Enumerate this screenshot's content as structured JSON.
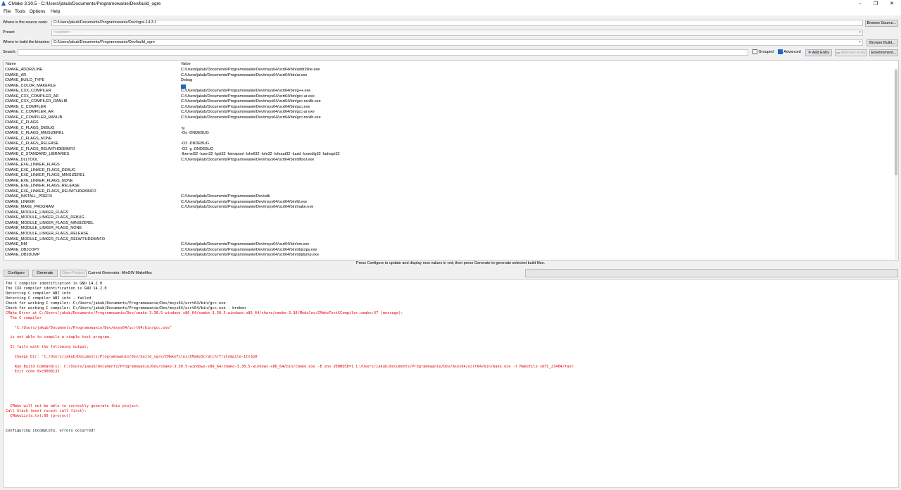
{
  "window": {
    "title": "CMake 3.30.5 - C:/Users/jakub/Documents/Programowanie/Dev/build_ogre",
    "minimize": "–",
    "maximize": "❐",
    "close": "✕"
  },
  "menu": [
    "File",
    "Tools",
    "Options",
    "Help"
  ],
  "source": {
    "label": "Where is the source code:",
    "value": "C:/Users/jakub/Documents/Programowanie/Dev/ogre-14.3.1",
    "browse": "Browse Source..."
  },
  "preset": {
    "label": "Preset:",
    "value": "<custom>"
  },
  "build": {
    "label": "Where to build the binaries:",
    "value": "C:/Users/jakub/Documents/Programowanie/Dev/build_ogre",
    "browse": "Browse Build..."
  },
  "search": {
    "label": "Search:",
    "value": "",
    "grouped": "Grouped",
    "advanced": "Advanced",
    "add_entry": "Add Entry",
    "remove_entry": "Remove Entry",
    "environment": "Environment..."
  },
  "table": {
    "col_name": "Name",
    "col_value": "Value",
    "rows": [
      {
        "name": "CMAKE_ADDR2LINE",
        "value": "C:/Users/jakub/Documents/Programowanie/Dev/msys64/ucrt64/bin/addr2line.exe"
      },
      {
        "name": "CMAKE_AR",
        "value": "C:/Users/jakub/Documents/Programowanie/Dev/msys64/ucrt64/bin/ar.exe"
      },
      {
        "name": "CMAKE_BUILD_TYPE",
        "value": "Debug"
      },
      {
        "name": "CMAKE_COLOR_MAKEFILE",
        "value": "",
        "checkbox": true
      },
      {
        "name": "CMAKE_CXX_COMPILER",
        "value": "C:/Users/jakub/Documents/Programowanie/Dev/msys64/ucrt64/bin/g++.exe"
      },
      {
        "name": "CMAKE_CXX_COMPILER_AR",
        "value": "C:/Users/jakub/Documents/Programowanie/Dev/msys64/ucrt64/bin/gcc-ar.exe"
      },
      {
        "name": "CMAKE_CXX_COMPILER_RANLIB",
        "value": "C:/Users/jakub/Documents/Programowanie/Dev/msys64/ucrt64/bin/gcc-ranlib.exe"
      },
      {
        "name": "CMAKE_C_COMPILER",
        "value": "C:/Users/jakub/Documents/Programowanie/Dev/msys64/ucrt64/bin/gcc.exe"
      },
      {
        "name": "CMAKE_C_COMPILER_AR",
        "value": "C:/Users/jakub/Documents/Programowanie/Dev/msys64/ucrt64/bin/gcc-ar.exe"
      },
      {
        "name": "CMAKE_C_COMPILER_RANLIB",
        "value": "C:/Users/jakub/Documents/Programowanie/Dev/msys64/ucrt64/bin/gcc-ranlib.exe"
      },
      {
        "name": "CMAKE_C_FLAGS",
        "value": ""
      },
      {
        "name": "CMAKE_C_FLAGS_DEBUG",
        "value": "-g"
      },
      {
        "name": "CMAKE_C_FLAGS_MINSIZEREL",
        "value": "-Os -DNDEBUG"
      },
      {
        "name": "CMAKE_C_FLAGS_NONE",
        "value": ""
      },
      {
        "name": "CMAKE_C_FLAGS_RELEASE",
        "value": "-O3 -DNDEBUG"
      },
      {
        "name": "CMAKE_C_FLAGS_RELWITHDEBINFO",
        "value": "-O2 -g -DNDEBUG"
      },
      {
        "name": "CMAKE_C_STANDARD_LIBRARIES",
        "value": "-lkernel32 -luser32 -lgdi32 -lwinspool -lshell32 -lole32 -loleaut32 -luuid -lcomdlg32 -ladvapi32"
      },
      {
        "name": "CMAKE_DLLTOOL",
        "value": "C:/Users/jakub/Documents/Programowanie/Dev/msys64/ucrt64/bin/dlltool.exe"
      },
      {
        "name": "CMAKE_EXE_LINKER_FLAGS",
        "value": ""
      },
      {
        "name": "CMAKE_EXE_LINKER_FLAGS_DEBUG",
        "value": ""
      },
      {
        "name": "CMAKE_EXE_LINKER_FLAGS_MINSIZEREL",
        "value": ""
      },
      {
        "name": "CMAKE_EXE_LINKER_FLAGS_NONE",
        "value": ""
      },
      {
        "name": "CMAKE_EXE_LINKER_FLAGS_RELEASE",
        "value": ""
      },
      {
        "name": "CMAKE_EXE_LINKER_FLAGS_RELWITHDEBINFO",
        "value": ""
      },
      {
        "name": "CMAKE_INSTALL_PREFIX",
        "value": "C:/Users/jakub/Documents/Programowanie/Dev/sdk"
      },
      {
        "name": "CMAKE_LINKER",
        "value": "C:/Users/jakub/Documents/Programowanie/Dev/msys64/ucrt64/bin/ld.exe"
      },
      {
        "name": "CMAKE_MAKE_PROGRAM",
        "value": "C:/Users/jakub/Documents/Programowanie/Dev/msys64/ucrt64/bin/make.exe"
      },
      {
        "name": "CMAKE_MODULE_LINKER_FLAGS",
        "value": ""
      },
      {
        "name": "CMAKE_MODULE_LINKER_FLAGS_DEBUG",
        "value": ""
      },
      {
        "name": "CMAKE_MODULE_LINKER_FLAGS_MINSIZEREL",
        "value": ""
      },
      {
        "name": "CMAKE_MODULE_LINKER_FLAGS_NONE",
        "value": ""
      },
      {
        "name": "CMAKE_MODULE_LINKER_FLAGS_RELEASE",
        "value": ""
      },
      {
        "name": "CMAKE_MODULE_LINKER_FLAGS_RELWITHDEBINFO",
        "value": ""
      },
      {
        "name": "CMAKE_NM",
        "value": "C:/Users/jakub/Documents/Programowanie/Dev/msys64/ucrt64/bin/nm.exe"
      },
      {
        "name": "CMAKE_OBJCOPY",
        "value": "C:/Users/jakub/Documents/Programowanie/Dev/msys64/ucrt64/bin/objcopy.exe"
      },
      {
        "name": "CMAKE_OBJDUMP",
        "value": "C:/Users/jakub/Documents/Programowanie/Dev/msys64/ucrt64/bin/objdump.exe"
      }
    ]
  },
  "status_message": "Press Configure to update and display new values in red, then press Generate to generate selected build files.",
  "actions": {
    "configure": "Configure",
    "generate": "Generate",
    "open_project": "Open Project",
    "generator": "Current Generator: MinGW Makefiles"
  },
  "output": [
    {
      "text": "The C compiler identification is GNU 14.2.0",
      "error": false
    },
    {
      "text": "The CXX compiler identification is GNU 14.2.0",
      "error": false
    },
    {
      "text": "Detecting C compiler ABI info",
      "error": false
    },
    {
      "text": "Detecting C compiler ABI info - failed",
      "error": false
    },
    {
      "text": "Check for working C compiler: C:/Users/jakub/Documents/Programowanie/Dev/msys64/ucrt64/bin/gcc.exe",
      "error": false
    },
    {
      "text": "Check for working C compiler: C:/Users/jakub/Documents/Programowanie/Dev/msys64/ucrt64/bin/gcc.exe - broken",
      "error": false
    },
    {
      "text": "CMake Error at C:/Users/jakub/Documents/Programowanie/Dev/cmake-3.30.5-windows-x86_64/cmake-3.30.5-windows-x86_64/share/cmake-3.30/Modules/CMakeTestCCompiler.cmake:67 (message):",
      "error": true
    },
    {
      "text": "  The C compiler",
      "error": true
    },
    {
      "text": "",
      "error": true
    },
    {
      "text": "    \"C:/Users/jakub/Documents/Programowanie/Dev/msys64/ucrt64/bin/gcc.exe\"",
      "error": true
    },
    {
      "text": "",
      "error": true
    },
    {
      "text": "  is not able to compile a simple test program.",
      "error": true
    },
    {
      "text": "",
      "error": true
    },
    {
      "text": "  It fails with the following output:",
      "error": true
    },
    {
      "text": "",
      "error": true
    },
    {
      "text": "    Change Dir: 'C:/Users/jakub/Documents/Programowanie/Dev/build_ogre/CMakeFiles/CMakeScratch/TryCompile-1tn3p0'",
      "error": true
    },
    {
      "text": "",
      "error": true
    },
    {
      "text": "    Run Build Command(s): C:/Users/jakub/Documents/Programowanie/Dev/cmake-3.30.5-windows-x86_64/cmake-3.30.5-windows-x86_64/bin/cmake.exe -E env VERBOSE=1 C:/Users/jakub/Documents/Programowanie/Dev/msys64/ucrt64/bin/make.exe -f Makefile cmTC_23404/fast",
      "error": true
    },
    {
      "text": "    Exit code 0xc0000135",
      "error": true
    },
    {
      "text": "",
      "error": true
    },
    {
      "text": "",
      "error": true
    },
    {
      "text": "",
      "error": true
    },
    {
      "text": "",
      "error": true
    },
    {
      "text": "",
      "error": true
    },
    {
      "text": "",
      "error": true
    },
    {
      "text": "  CMake will not be able to correctly generate this project.",
      "error": true
    },
    {
      "text": "Call Stack (most recent call first):",
      "error": true
    },
    {
      "text": "  CMakeLists.txt:66 (project)",
      "error": true
    },
    {
      "text": "",
      "error": false
    },
    {
      "text": "",
      "error": false
    },
    {
      "text": "Configuring incomplete, errors occurred!",
      "error": false
    }
  ],
  "colors": {
    "accent": "#1f66c2",
    "error_text": "#e00000"
  }
}
